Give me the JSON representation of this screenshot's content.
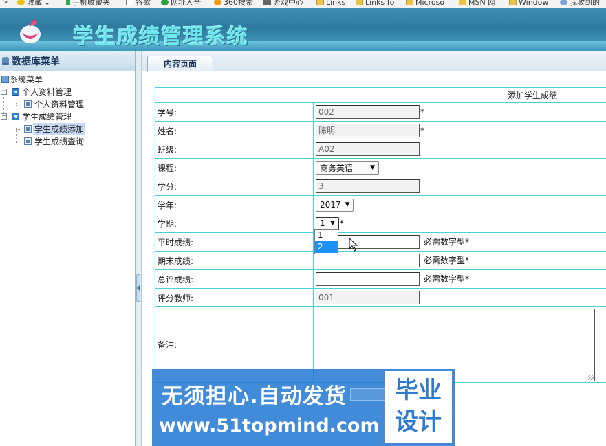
{
  "favorites_bar": {
    "items": [
      {
        "label": "收藏",
        "icon": "star-icon"
      },
      {
        "label": "手机收藏夹",
        "icon": "phone-icon"
      },
      {
        "label": "谷歌",
        "icon": "page-icon"
      },
      {
        "label": "网址大全",
        "icon": "plus-circle-icon"
      },
      {
        "label": "360搜索",
        "icon": "search-360-icon"
      },
      {
        "label": "游戏中心",
        "icon": "gamepad-icon"
      },
      {
        "label": "Links",
        "icon": "folder-icon"
      },
      {
        "label": "Links fo",
        "icon": "folder-icon"
      },
      {
        "label": "Microso",
        "icon": "folder-icon"
      },
      {
        "label": "MSN 网",
        "icon": "folder-icon"
      },
      {
        "label": "Window",
        "icon": "folder-icon"
      },
      {
        "label": "我收到的",
        "icon": "magnifier-icon"
      }
    ]
  },
  "header": {
    "title": "学生成绩管理系统",
    "colors": {
      "title": "#6fe6ee",
      "bar": "#2f79a0"
    }
  },
  "sidebar": {
    "heading": "数据库菜单",
    "tree": [
      {
        "label": "系统菜单",
        "level": 0,
        "icon": "system-menu-icon"
      },
      {
        "label": "个人资料管理",
        "level": 1,
        "icon": "folder-icon",
        "expanded": true
      },
      {
        "label": "个人资料管理",
        "level": 2,
        "icon": "page-icon"
      },
      {
        "label": "学生成绩管理",
        "level": 1,
        "icon": "folder-icon",
        "expanded": true
      },
      {
        "label": "学生成绩添加",
        "level": 2,
        "icon": "page-icon",
        "selected": true
      },
      {
        "label": "学生成绩查询",
        "level": 2,
        "icon": "page-icon"
      }
    ]
  },
  "main": {
    "tab_label": "内容页面",
    "form": {
      "title": "添加学生成绩",
      "student_id": {
        "label": "学号:",
        "value": "002",
        "required_mark": "*"
      },
      "name": {
        "label": "姓名:",
        "value": "陈明",
        "required_mark": "*"
      },
      "class": {
        "label": "班级:",
        "value": "A02"
      },
      "course": {
        "label": "课程:",
        "selected": "商务英语"
      },
      "credit": {
        "label": "学分:",
        "value": "3"
      },
      "year": {
        "label": "学年:",
        "selected": "2017"
      },
      "term": {
        "label": "学期:",
        "selected": "1",
        "required_mark": "*",
        "open_options": [
          "1",
          "2"
        ],
        "highlighted": "2"
      },
      "usual_score": {
        "label": "平时成绩:",
        "value": "",
        "hint": "必需数字型*"
      },
      "final_score": {
        "label": "期末成绩:",
        "value": "",
        "hint": "必需数字型*"
      },
      "total_score": {
        "label": "总评成绩:",
        "value": "",
        "hint": "必需数字型*"
      },
      "teacher": {
        "label": "评分教师:",
        "value": "001"
      },
      "remark": {
        "label": "备注:",
        "value": ""
      }
    }
  },
  "watermark": {
    "line1": "无须担心.自动发货",
    "url": "www.51topmind.com",
    "box_line1": "毕业",
    "box_line2": "设计",
    "color": "#2378d2"
  }
}
